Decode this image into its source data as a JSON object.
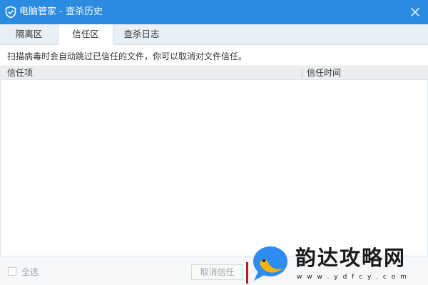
{
  "window": {
    "title": "电脑管家 - 查杀历史",
    "title_bar_color": "#2b8be0",
    "icons": {
      "app": "shield-icon",
      "close": "close-icon"
    }
  },
  "tabs": [
    {
      "label": "隔离区",
      "active": false
    },
    {
      "label": "信任区",
      "active": true
    },
    {
      "label": "查杀日志",
      "active": false
    }
  ],
  "trust_zone": {
    "description": "扫描病毒时会自动跳过已信任的文件，你可以取消对文件信任。",
    "columns": {
      "item": "信任项",
      "time": "信任时间"
    },
    "rows": []
  },
  "footer": {
    "select_all_label": "全选",
    "select_all_checked": false,
    "cancel_trust_label": "取消信任"
  },
  "watermark": {
    "name": "韵达攻略网",
    "url": "w w w . y d f c y . c o m",
    "logo_icon": "bird-speech-bubble-logo",
    "colors": {
      "bubble": "#2e8bf0",
      "bird": "#f5b400"
    }
  }
}
